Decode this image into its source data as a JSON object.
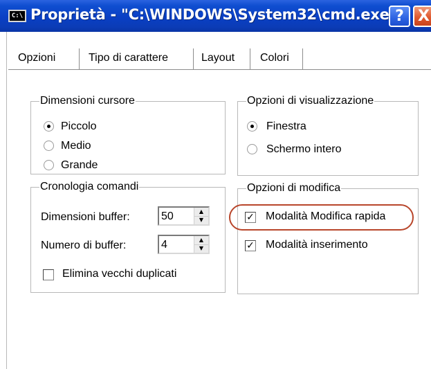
{
  "window": {
    "title": "Proprietà - \"C:\\WINDOWS\\System32\\cmd.exe\"",
    "icon_text": "C:\\",
    "help_label": "?",
    "close_label": "X"
  },
  "tabs": [
    {
      "label": "Opzioni",
      "active": true
    },
    {
      "label": "Tipo di carattere",
      "active": false
    },
    {
      "label": "Layout",
      "active": false
    },
    {
      "label": "Colori",
      "active": false
    }
  ],
  "cursor_size": {
    "legend": "Dimensioni cursore",
    "options": [
      "Piccolo",
      "Medio",
      "Grande"
    ],
    "selected": "Piccolo"
  },
  "display_options": {
    "legend": "Opzioni di visualizzazione",
    "options": [
      "Finestra",
      "Schermo intero"
    ],
    "selected": "Finestra"
  },
  "command_history": {
    "legend": "Cronologia comandi",
    "buffer_size_label": "Dimensioni buffer:",
    "buffer_size_value": "50",
    "buffer_count_label": "Numero di buffer:",
    "buffer_count_value": "4",
    "discard_duplicates_label": "Elimina vecchi duplicati",
    "discard_duplicates_checked": false
  },
  "edit_options": {
    "legend": "Opzioni di modifica",
    "quickedit_label": "Modalità Modifica rapida",
    "quickedit_checked": true,
    "insert_label": "Modalità inserimento",
    "insert_checked": true
  },
  "colors": {
    "titlebar": "#0a3fc4",
    "highlight_ring": "#b8452a",
    "close_button": "#e05a30"
  }
}
